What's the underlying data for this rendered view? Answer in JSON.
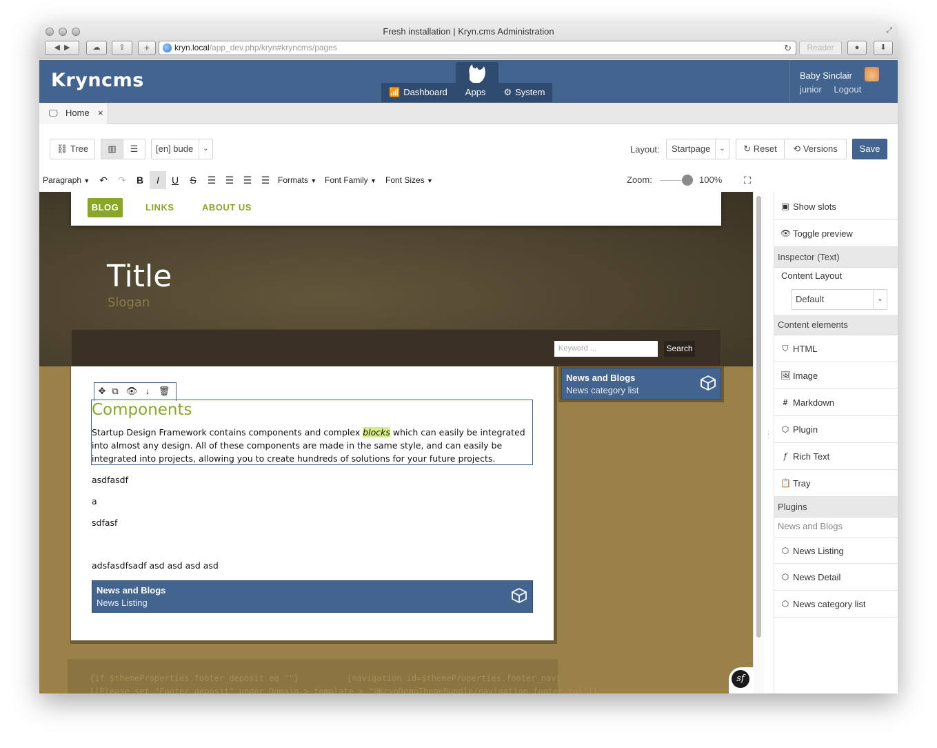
{
  "window": {
    "title": "Fresh installation | Kryn.cms Administration"
  },
  "browser": {
    "url_host": "kryn.local",
    "url_path": "/app_dev.php/kryn#kryncms/pages",
    "reader": "Reader"
  },
  "header": {
    "logo": "Kryncms",
    "tabs": {
      "dashboard": "Dashboard",
      "apps": "Apps",
      "system": "System"
    },
    "user": {
      "name": "Baby Sinclair",
      "role": "junior",
      "logout": "Logout"
    }
  },
  "tabbar": {
    "home": "Home",
    "close": "×"
  },
  "toolbar": {
    "tree": "Tree",
    "language": "[en] bude",
    "layout_label": "Layout:",
    "layout_value": "Startpage",
    "reset": "Reset",
    "versions": "Versions",
    "save": "Save"
  },
  "editor": {
    "paragraph": "Paragraph",
    "bold": "B",
    "italic": "I",
    "underline": "U",
    "strike": "S",
    "formats": "Formats",
    "font_family": "Font Family",
    "font_sizes": "Font Sizes",
    "zoom_label": "Zoom:",
    "zoom_value": "100%",
    "zoom_level": 1.0
  },
  "page": {
    "nav": [
      "BLOG",
      "LINKS",
      "ABOUT US"
    ],
    "title": "Title",
    "slogan": "Slogan",
    "search_placeholder": "Keyword ...",
    "search_button": "Search",
    "component_title": "Components",
    "component_text_before": "Startup Design Framework contains components and complex ",
    "component_text_em": "blocks",
    "component_text_after": " which can easily be integrated into almost any design. All of these components are made in the same style, and can easily be integrated into projects, allowing you to create hundreds of solutions for your future projects.",
    "p1": "asdfasdf",
    "p2": "a",
    "p3": "sdfasf",
    "p4": "adsfasdfsadf asd asd asd asd",
    "plugin_block": {
      "title": "News and Blogs",
      "subtitle": "News Listing"
    },
    "side_block": {
      "title": "News and Blogs",
      "subtitle": "News category list"
    },
    "footer_left": "{if $themeProperties.footer_deposit eq \"\"}",
    "footer_right": "{navigation id=$themeProperties.footer_navi",
    "footer_line2": "[[Please set \"Footer deposit\" under Domain > template > \"@KrynDemoThemeBundle/navigation_footer.tpl\"]]"
  },
  "panel": {
    "show_slots": "Show slots",
    "toggle_preview": "Toggle preview",
    "inspector": "Inspector (Text)",
    "content_layout": "Content Layout",
    "content_layout_value": "Default",
    "content_elements": "Content elements",
    "elements": [
      "HTML",
      "Image",
      "Markdown",
      "Plugin",
      "Rich Text",
      "Tray"
    ],
    "plugins": "Plugins",
    "plugin_group": "News and Blogs",
    "plugin_items": [
      "News Listing",
      "News Detail",
      "News category list"
    ]
  },
  "colors": {
    "brand": "#43648f",
    "accent": "#8aa626",
    "save": "#43648f"
  }
}
